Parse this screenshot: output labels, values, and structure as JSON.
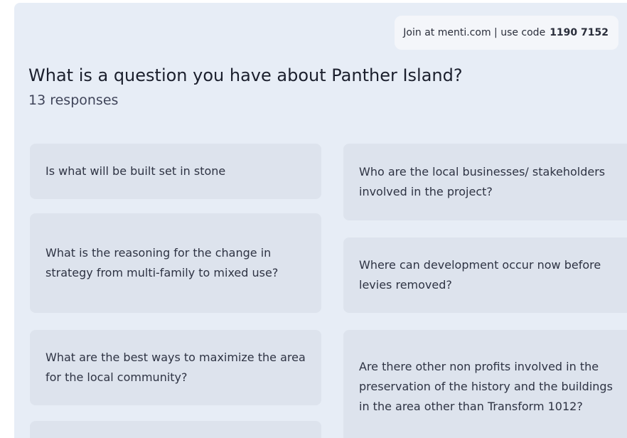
{
  "join": {
    "text": "Join at menti.com | use code",
    "code": "1190 7152"
  },
  "question": {
    "title": "What is a question you have about Panther Island?",
    "count": "13 responses"
  },
  "responses": [
    "Is what will be built set in stone",
    "Who are the local businesses/ stakeholders involved in the project?",
    "What is the reasoning for the change in strategy from multi-family to mixed use?",
    "Where can development occur now before levies removed?",
    "What are the best ways to maximize the area for the local community?",
    "Are there other non profits involved in the preservation of the history and the buildings in the area other than Transform 1012?",
    "",
    ""
  ],
  "colors": {
    "background": "#e7edf6",
    "card": "#dde3ed",
    "pill": "#f4f6fa",
    "text": "#1f2333"
  }
}
